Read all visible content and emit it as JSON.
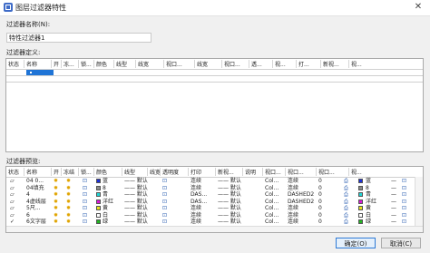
{
  "window": {
    "title": "图层过滤器特性",
    "close_glyph": "✕"
  },
  "name_label": "过滤器名称(N):",
  "name_value": "特性过滤器1",
  "definition_label": "过滤器定义:",
  "definition_headers": [
    "状态",
    "名称",
    "开",
    "冻...",
    "锁...",
    "颜色",
    "线型",
    "线宽",
    "视口...",
    "线宽",
    "视口...",
    "透...",
    "视...",
    "打...",
    "新视...",
    "视..."
  ],
  "preview_label": "过滤器预览:",
  "preview_headers": [
    "状态",
    "名称",
    "开",
    "冻结",
    "锁...",
    "颜色",
    "线型",
    "线宽",
    "透明度",
    "打印",
    "新视...",
    "说明",
    "视口...",
    "视口...",
    "视口...",
    "视..."
  ],
  "rows": [
    {
      "status": "▱",
      "name": "04 0...",
      "color_num": "蓝",
      "color": "#1c2fd6",
      "linetype": "——  默认",
      "transp": "0",
      "plot": "连续",
      "newvp": "—— 默认",
      "desc": "Col...",
      "vpltype": "连续",
      "vplw": "0",
      "vpcolor": "蓝"
    },
    {
      "status": "▱",
      "name": "04填充",
      "color_num": "8",
      "color": "#8a8a8a",
      "linetype": "——  默认",
      "transp": "0",
      "plot": "连续",
      "newvp": "—— 默认",
      "desc": "Col...",
      "vpltype": "连续",
      "vplw": "0",
      "vpcolor": "8"
    },
    {
      "status": "▱",
      "name": "4",
      "color_num": "青",
      "color": "#20d7d7",
      "linetype": "——  默认",
      "transp": "0",
      "plot": "DAS...",
      "newvp": "—— 默认",
      "desc": "Col...",
      "vpltype": "DASHED2",
      "vplw": "0",
      "vpcolor": "青"
    },
    {
      "status": "▱",
      "name": "4虚线层",
      "color_num": "洋红",
      "color": "#d81ad8",
      "linetype": "——  默认",
      "transp": "0",
      "plot": "DAS...",
      "newvp": "—— 默认",
      "desc": "Col...",
      "vpltype": "DASHED2",
      "vplw": "0",
      "vpcolor": "洋红"
    },
    {
      "status": "▱",
      "name": "5尺...",
      "color_num": "黄",
      "color": "#e7e21c",
      "linetype": "——  默认",
      "transp": "0",
      "plot": "连续",
      "newvp": "—— 默认",
      "desc": "Col...",
      "vpltype": "连续",
      "vplw": "0",
      "vpcolor": "黄"
    },
    {
      "status": "▱",
      "name": "6",
      "color_num": "白",
      "color": "#ffffff",
      "linetype": "——  默认",
      "transp": "0",
      "plot": "连续",
      "newvp": "—— 默认",
      "desc": "Col...",
      "vpltype": "连续",
      "vplw": "0",
      "vpcolor": "白"
    },
    {
      "status": "✓",
      "name": "6文字层",
      "color_num": "绿",
      "color": "#22b522",
      "linetype": "——  默认",
      "transp": "0",
      "plot": "连续",
      "newvp": "—— 默认",
      "desc": "Col...",
      "vpltype": "连续",
      "vplw": "0",
      "vpcolor": "绿"
    }
  ],
  "buttons": {
    "ok": "确定(O)",
    "cancel": "取消(C)"
  }
}
